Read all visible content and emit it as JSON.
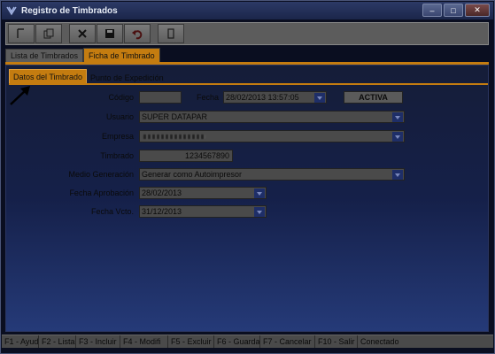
{
  "window": {
    "title": "Registro de Timbrados"
  },
  "window_buttons": {
    "minimize": "–",
    "maximize": "□",
    "close": "✕"
  },
  "toolbar": {
    "icons": [
      "new-icon",
      "copy-icon",
      "delete-icon",
      "save-icon",
      "undo-icon",
      "exit-icon"
    ]
  },
  "tabs": [
    {
      "label": "Lista de Timbrados",
      "active": false
    },
    {
      "label": "Ficha de Timbrado",
      "active": true
    }
  ],
  "subtabs": [
    {
      "label": "Datos del Timbrado",
      "active": true
    },
    {
      "label": "Punto de Expedición",
      "active": false
    }
  ],
  "form": {
    "codigo": {
      "label": "Código",
      "value": ""
    },
    "fecha": {
      "label": "Fecha",
      "value": "28/02/2013 13:57:05"
    },
    "estado": {
      "value": "ACTIVA"
    },
    "usuario": {
      "label": "Usuario",
      "value": "SUPER DATAPAR"
    },
    "empresa": {
      "label": "Empresa",
      "value": ""
    },
    "timbrado": {
      "label": "Timbrado",
      "value": "1234567890"
    },
    "medio_generacion": {
      "label": "Medio Generación",
      "value": "Generar como Autoimpresor"
    },
    "fecha_aprobacion": {
      "label": "Fecha Aprobación",
      "value": "28/02/2013"
    },
    "fecha_vcto": {
      "label": "Fecha Vcto.",
      "value": "31/12/2013"
    }
  },
  "statusbar": {
    "items": [
      "F1 - Ayud",
      "F2 - Lista",
      "F3 - Incluir",
      "F4 - Modifi",
      "F5 - Excluir",
      "F6 - Guarda",
      "F7 - Cancelar",
      "F10 - Salir",
      "Conectado"
    ]
  },
  "colors": {
    "accent": "#c47c10",
    "panel_bottom": "#253a78",
    "dropdown": "#1e2e68"
  }
}
